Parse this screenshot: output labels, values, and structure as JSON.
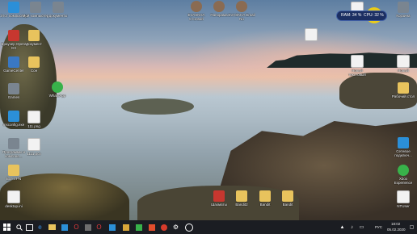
{
  "desktop_icons": {
    "recycle_bin": "Этот компьютер",
    "my_computer": "Мой компьютер",
    "docs": "документы",
    "avatar1": "EVASKHA Столвой",
    "avatar2": "Панорама",
    "avatar3": "EVASKHA Email No",
    "opera": "Браузер Opera GX",
    "word": "Документ",
    "gamecenter": "GameCenter",
    "cc": "Сон",
    "games": "Games",
    "whatsapp": "WhatsApp",
    "msconfig": "msconfig.exe",
    "img": "111.png",
    "programs": "Программы и компоне...",
    "pics": "1111.pcx",
    "all_vpn": "Все VPN",
    "desktop": "desktop.ini",
    "file_top": "",
    "file_right1": "Новый текстовый",
    "file_right2": "Новый",
    "folder_right": "Рабочий стол",
    "network": "Сетевое подключ...",
    "xbox": "Xbox Experience",
    "files_bottom1": "Шахматы",
    "files_bottom2": "Bandit2",
    "files_bottom3": "Bandit",
    "files_bottom4": "Bandit",
    "dropbox": "Корзина",
    "ntuser": "NTUser"
  },
  "widget": {
    "ram": "RAM: 34 %",
    "cpu": "CPU: 32 %"
  },
  "tray": {
    "lang": "РУС",
    "time": "18:02",
    "date": "05.02.2020"
  }
}
